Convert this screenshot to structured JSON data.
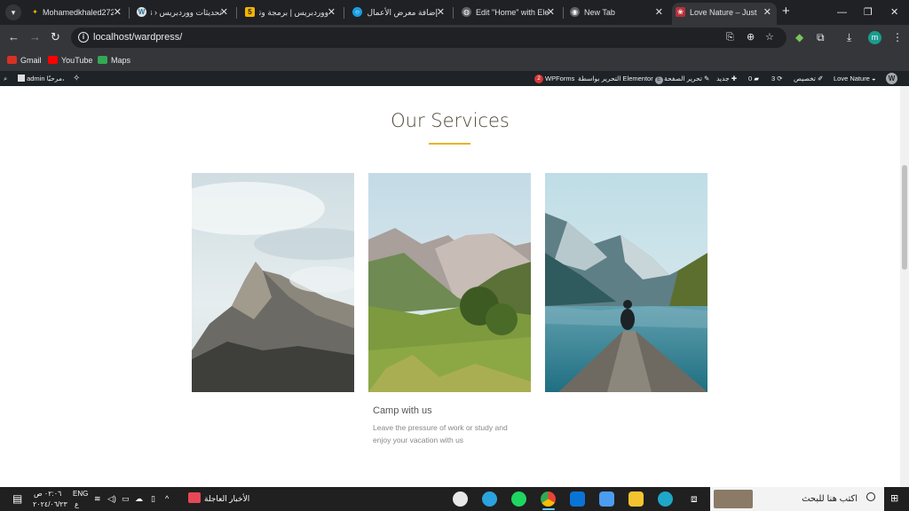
{
  "browser": {
    "tab_menu_icon": "chevron-down",
    "tabs": [
      {
        "title": "Mohamedkhaled272"
      },
      {
        "title": "تحديثات ووردبريس ‹ s"
      },
      {
        "title": "ووردبريس | برمجة وتط"
      },
      {
        "title": "إضافة معرض الأعمال"
      },
      {
        "title": "Edit \"Home\" with Ele"
      },
      {
        "title": "New Tab"
      },
      {
        "title": "Love Nature – Just ar"
      }
    ],
    "close_glyph": "✕",
    "new_tab_glyph": "+",
    "window_controls": {
      "minimize": "—",
      "maximize": "❐",
      "close": "✕"
    },
    "url": "localhost/wardpress/",
    "profile_initial": "m"
  },
  "bookmarks": [
    {
      "label": "Gmail",
      "color": "#d93025"
    },
    {
      "label": "YouTube",
      "color": "#ff0000"
    },
    {
      "label": "Maps",
      "color": "#34a853"
    }
  ],
  "wp_admin_bar": {
    "site_name": "Love Nature",
    "customize": "تخصيص",
    "updates_count": "3",
    "comments_count": "0",
    "new": "جديد",
    "edit_page": "تحرير الصفحة",
    "elementor_edit": "التحرير بواسطة Elementor",
    "wpforms_badge": "2",
    "wpforms": "WPForms",
    "greeting": "مرحبًا،",
    "user": "admin"
  },
  "page": {
    "section_title": "Our Services",
    "cards": [
      {
        "image": "foggy-mountain-peak"
      },
      {
        "image": "green-mountain-valley"
      },
      {
        "image": "person-on-lake-dock"
      }
    ],
    "service_title": "Camp with us",
    "service_desc": "Leave the pressure of work or study and enjoy your vacation with us"
  },
  "taskbar": {
    "time": "٠٢:٠٦ ص",
    "date": "٢٠٢٤/٠٦/٢٣",
    "language": "ENG",
    "language_sub": "ع",
    "news": "الأخبار العاجلة",
    "search_placeholder": "اكتب هنا للبحث",
    "apps": [
      {
        "name": "wordpress-app",
        "color": "#e8e8e8"
      },
      {
        "name": "telegram-app",
        "color": "#2aa3df"
      },
      {
        "name": "spotify-app",
        "color": "#1ed760"
      },
      {
        "name": "chrome-app",
        "color": "#fbbc05"
      },
      {
        "name": "mail-app",
        "color": "#0a74d6"
      },
      {
        "name": "store-app",
        "color": "#4c9cf0"
      },
      {
        "name": "explorer-app",
        "color": "#f4c430"
      },
      {
        "name": "edge-app",
        "color": "#1fa7c9"
      }
    ]
  }
}
